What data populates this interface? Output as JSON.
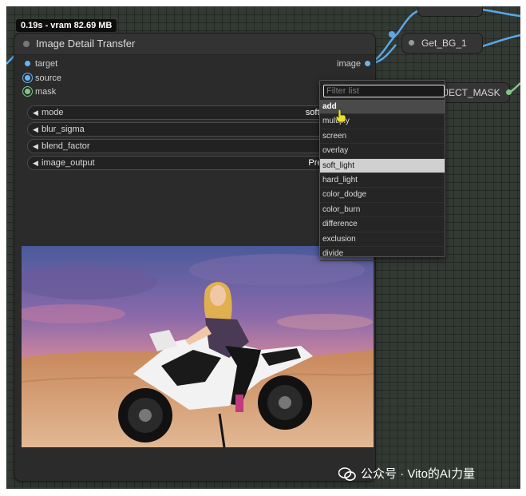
{
  "stats_badge": "0.19s - vram 82.69 MB",
  "node": {
    "title": "Image Detail Transfer",
    "inputs": [
      {
        "label": "target",
        "color": "#64b5f6"
      },
      {
        "label": "source",
        "color": "#64b5f6"
      },
      {
        "label": "mask",
        "color": "#81c784"
      }
    ],
    "output": {
      "label": "image",
      "color": "#64b5f6"
    },
    "widgets": [
      {
        "label": "mode",
        "value": "soft_l"
      },
      {
        "label": "blur_sigma",
        "value": "5"
      },
      {
        "label": "blend_factor",
        "value": "1."
      },
      {
        "label": "image_output",
        "value": "Prev"
      }
    ]
  },
  "other_nodes": {
    "get_bg": "Get_BG_1",
    "subject_mask": "JECT_MASK"
  },
  "dropdown": {
    "filter_placeholder": "Filter list",
    "items": [
      "add",
      "multiply",
      "screen",
      "overlay",
      "soft_light",
      "hard_light",
      "color_dodge",
      "color_burn",
      "difference",
      "exclusion",
      "divide"
    ],
    "hovered": "add",
    "selected": "soft_light"
  },
  "watermark": "公众号 · Vito的AI力量",
  "colors": {
    "wire_blue": "#5aa8e6",
    "image_pin": "#64b5f6",
    "mask_pin": "#81c784"
  }
}
